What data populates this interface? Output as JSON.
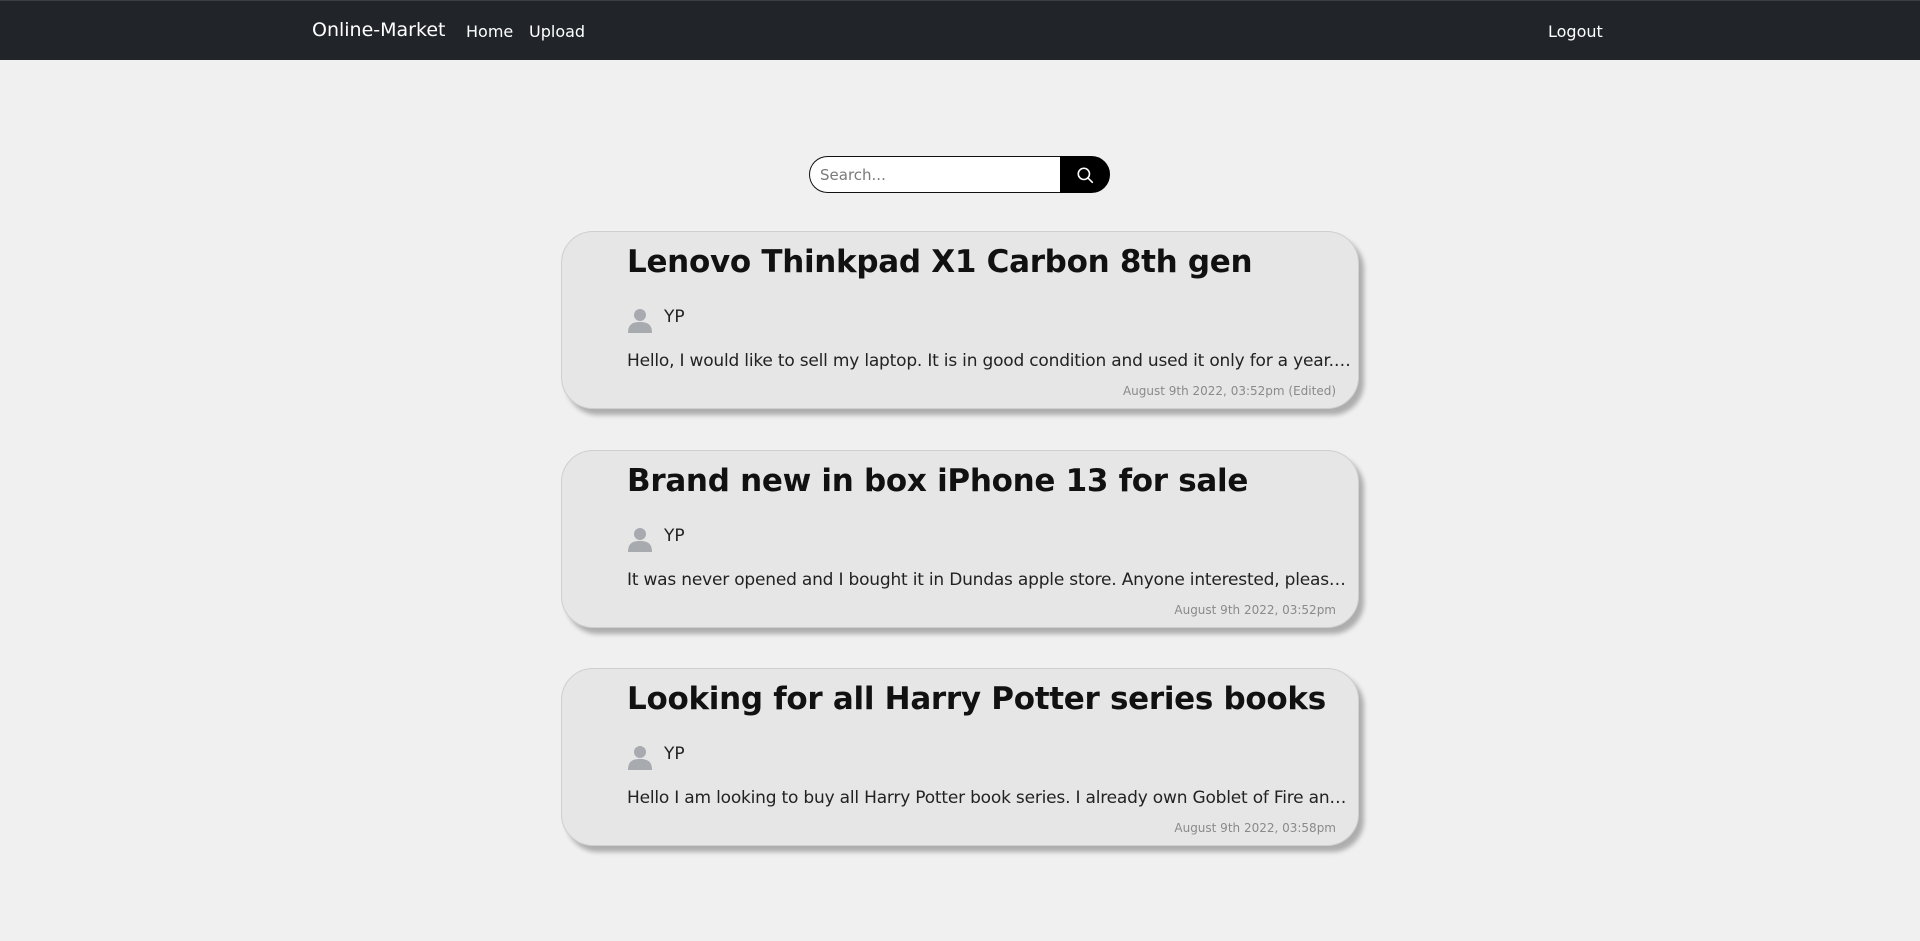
{
  "navbar": {
    "brand": "Online-Market",
    "home": "Home",
    "upload": "Upload",
    "logout": "Logout"
  },
  "search": {
    "placeholder": "Search...",
    "value": "",
    "icon": "search-icon"
  },
  "posts": [
    {
      "title": "Lenovo Thinkpad X1 Carbon 8th gen",
      "author": "YP",
      "excerpt": "Hello, I would like to sell my laptop. It is in good condition and used it only for a year. My...",
      "timestamp": "August 9th 2022, 03:52pm (Edited)"
    },
    {
      "title": "Brand new in box iPhone 13 for sale",
      "author": "YP",
      "excerpt": "It was never opened and I bought it in Dundas apple store. Anyone interested, please con...",
      "timestamp": "August 9th 2022, 03:52pm"
    },
    {
      "title": "Looking for all Harry Potter series books",
      "author": "YP",
      "excerpt": "Hello I am looking to buy all Harry Potter book series. I already own Goblet of Fire and Ha...",
      "timestamp": "August 9th 2022, 03:58pm"
    }
  ],
  "colors": {
    "navbar_bg": "#212529",
    "page_bg": "#f0f0f0",
    "card_bg": "#e6e6e6",
    "avatar_icon": "#a7abb0"
  }
}
